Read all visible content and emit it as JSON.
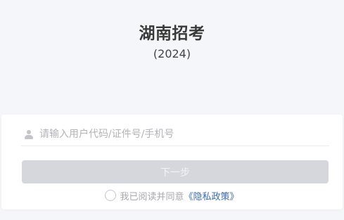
{
  "header": {
    "title": "湖南招考",
    "year": "(2024)"
  },
  "login": {
    "account_placeholder": "请输入用户代码/证件号/手机号",
    "account_value": "",
    "next_label": "下一步",
    "agreement_text": "我已阅读并同意",
    "privacy_link": "《隐私政策》",
    "agreed": false
  },
  "colors": {
    "background": "#f5f6fa",
    "button_disabled": "#d6d7dd",
    "link": "#3b6bb3"
  }
}
